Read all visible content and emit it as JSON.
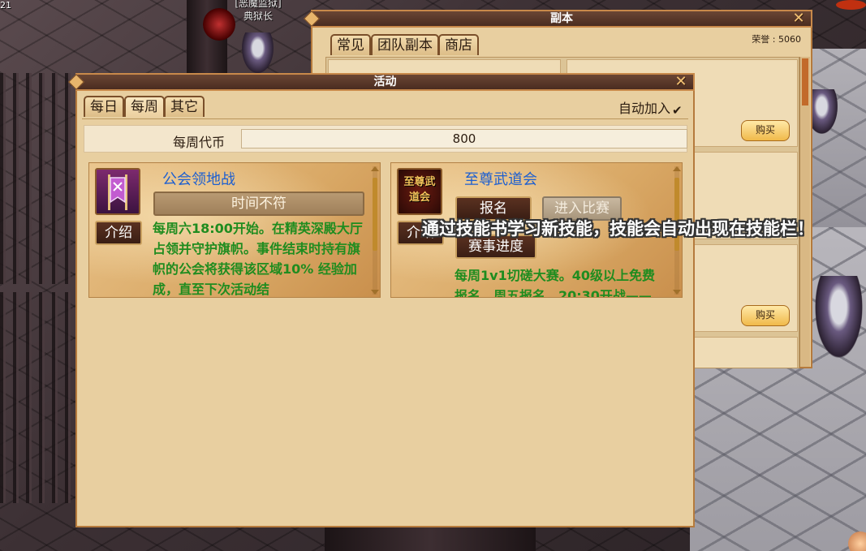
{
  "hud": {
    "corner_number": "21"
  },
  "npc": {
    "guild": "[恶魔监狱]",
    "name": "典狱长"
  },
  "dungeon_window": {
    "title": "副本",
    "tabs": [
      "常见",
      "团队副本",
      "商店"
    ],
    "honor": "荣誉 : 5060",
    "buy_label": "购买"
  },
  "activity_window": {
    "title": "活动",
    "tabs": [
      "每日",
      "每周",
      "其它"
    ],
    "active_tab": "每周",
    "auto_join_label": "自动加入",
    "auto_join_checked": true,
    "token_label": "每周代币",
    "token_value": "800",
    "events": [
      {
        "title": "公会领地战",
        "status": "时间不符",
        "intro_label": "介绍",
        "description": "每周六18:00开始。在精英深殿大厅占领并守护旗帜。事件结束时持有旗帜的公会将获得该区域10% 经验加成，直至下次活动结"
      },
      {
        "title": "至尊武道会",
        "icon_text": "至尊武道会",
        "intro_label": "介绍",
        "signup_label": "报名",
        "enter_label": "进入比赛",
        "progress_label": "赛事进度",
        "description": "每周1v1切磋大赛。40级以上免费报名，周五报名，20:30开战——"
      }
    ]
  },
  "system_tip": "通过技能书学习新技能，技能会自动出现在技能栏！"
}
